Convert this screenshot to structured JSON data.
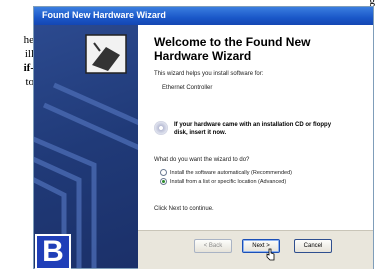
{
  "doc": {
    "top_fragment": "g",
    "lines": [
      "he",
      "ill",
      "if-",
      "to"
    ]
  },
  "wizard": {
    "window_title": "Found New Hardware Wizard",
    "heading": "Welcome to the Found New Hardware Wizard",
    "intro": "This wizard helps you install software for:",
    "device": "Ethernet Controller",
    "cd_note": "If your hardware came with an installation CD or floppy disk, insert it now.",
    "question": "What do you want the wizard to do?",
    "options": [
      {
        "label": "Install the software automatically (Recommended)",
        "selected": false
      },
      {
        "label": "Install from a list or specific location (Advanced)",
        "selected": true
      }
    ],
    "continue_text": "Click Next to continue.",
    "buttons": {
      "back": "< Back",
      "next": "Next >",
      "cancel": "Cancel"
    }
  },
  "badge": {
    "label": "B",
    "color": "#1f3eb8"
  }
}
